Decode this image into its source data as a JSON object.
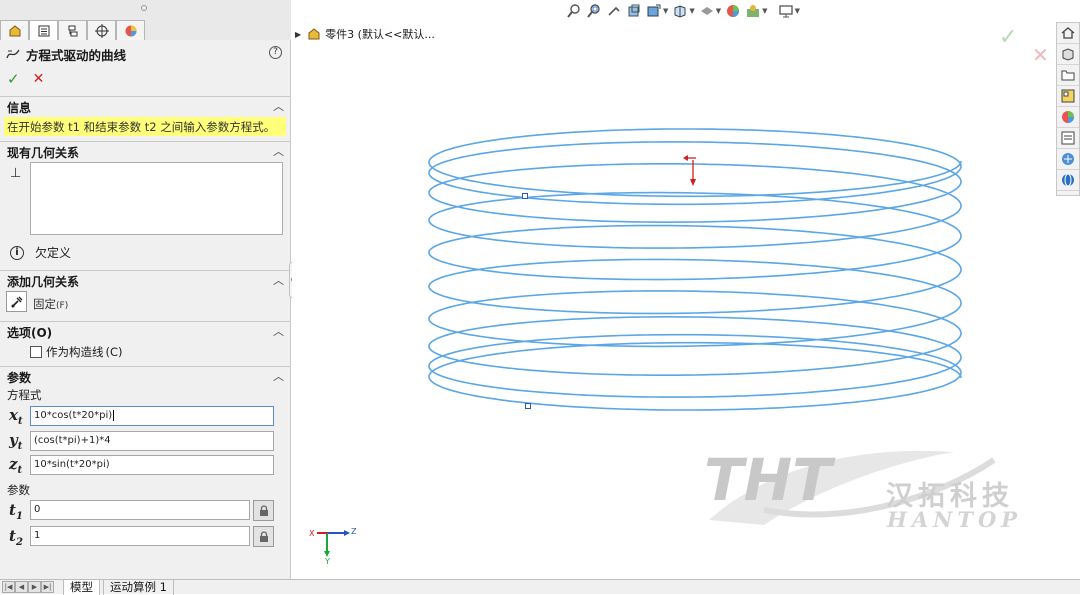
{
  "panel": {
    "tabs": [
      "feature-manager-icon",
      "property-manager-icon",
      "configuration-manager-icon",
      "dimxpert-icon",
      "display-manager-icon"
    ],
    "title": "方程式驱动的曲线",
    "help": "?",
    "ok": "✓",
    "cancel": "✕",
    "info": {
      "heading": "信息",
      "message": "在开始参数 t1 和结束参数 t2 之间输入参数方程式。"
    },
    "existing_relations": {
      "heading": "现有几何关系",
      "status": "欠定义"
    },
    "add_relations": {
      "heading": "添加几何关系",
      "fix_label": "固定",
      "fix_hotkey": "(F)"
    },
    "options": {
      "heading": "选项(O)",
      "construction_label": "作为构造线",
      "construction_hotkey": "(C)",
      "construction_checked": false
    },
    "parameters": {
      "heading": "参数",
      "equation_label": "方程式",
      "x_var": "x",
      "x_sub": "t",
      "x_value": "10*cos(t*20*pi)",
      "y_var": "y",
      "y_sub": "t",
      "y_value": "(cos(t*pi)+1)*4",
      "z_var": "z",
      "z_sub": "t",
      "z_value": "10*sin(t*20*pi)",
      "param_label": "参数",
      "t1_var": "t",
      "t1_sub": "1",
      "t1_value": "0",
      "t2_var": "t",
      "t2_sub": "2",
      "t2_value": "1"
    }
  },
  "viewport": {
    "tree_label": "零件3  (默认<<默认...",
    "confirm_ok": "✓",
    "confirm_cancel": "✕",
    "triad": {
      "x": "X",
      "y": "Y",
      "z": "Z"
    },
    "watermark": {
      "logo": "THT",
      "cn": "汉拓科技",
      "en": "HANTOP"
    },
    "curve_color": "#5aa6e6"
  },
  "bottom": {
    "tabs": [
      "模型",
      "运动算例 1"
    ],
    "active_tab": "模型"
  }
}
